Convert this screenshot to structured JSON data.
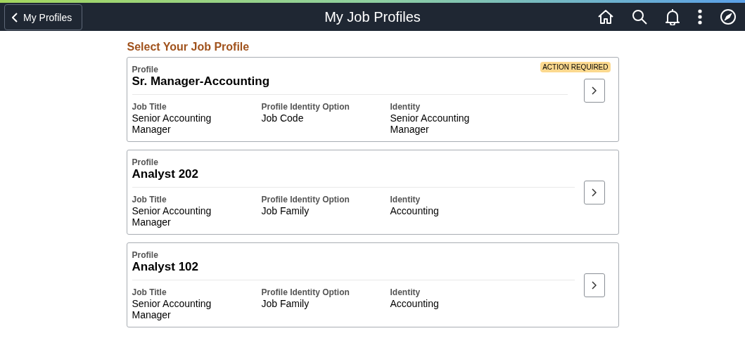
{
  "header": {
    "back_button": "My Profiles",
    "title": "My Job Profiles"
  },
  "section_title": "Select Your Job Profile",
  "profiles": [
    {
      "label": "Profile",
      "name": "Sr. Manager-Accounting",
      "badge": "ACTION REQUIRED",
      "fields": [
        {
          "label": "Job Title",
          "value": "Senior Accounting Manager"
        },
        {
          "label": "Profile Identity Option",
          "value": "Job Code"
        },
        {
          "label": "Identity",
          "value": "Senior Accounting Manager"
        }
      ]
    },
    {
      "label": "Profile",
      "name": "Analyst 202",
      "fields": [
        {
          "label": "Job Title",
          "value": "Senior Accounting Manager"
        },
        {
          "label": "Profile Identity Option",
          "value": "Job Family"
        },
        {
          "label": "Identity",
          "value": "Accounting"
        }
      ]
    },
    {
      "label": "Profile",
      "name": "Analyst 102",
      "fields": [
        {
          "label": "Job Title",
          "value": "Senior Accounting Manager"
        },
        {
          "label": "Profile Identity Option",
          "value": "Job Family"
        },
        {
          "label": "Identity",
          "value": "Accounting"
        }
      ]
    }
  ]
}
